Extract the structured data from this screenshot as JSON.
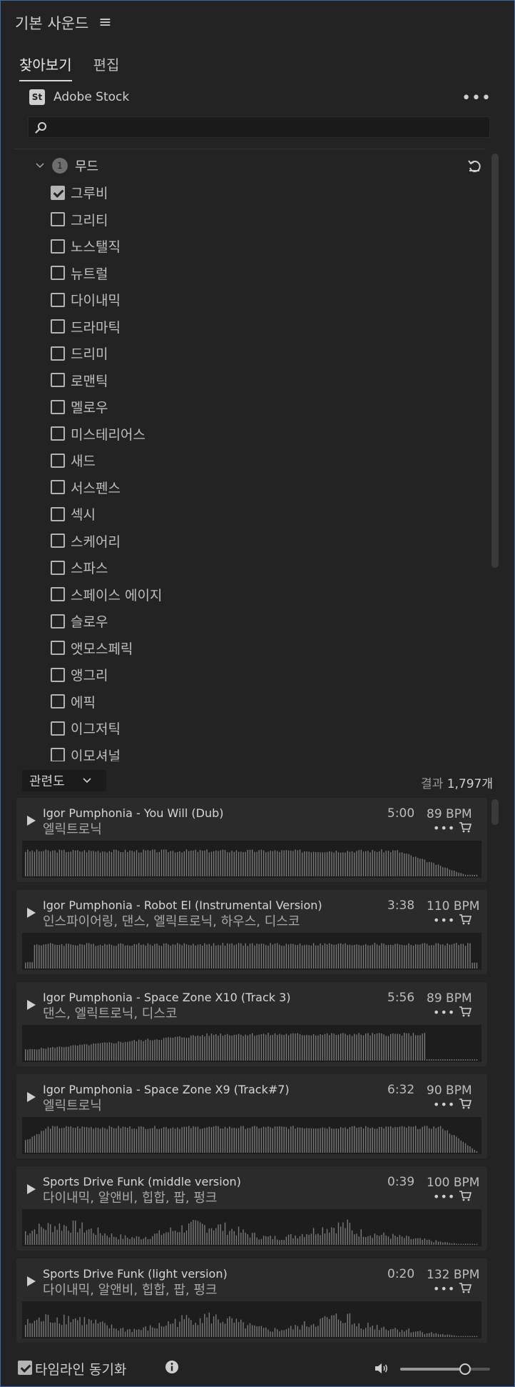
{
  "panel": {
    "title": "기본 사운드",
    "menu_icon": "hamburger-menu-icon"
  },
  "tabs": [
    {
      "label": "찾아보기",
      "active": true
    },
    {
      "label": "편집",
      "active": false
    }
  ],
  "stock": {
    "logo_text": "St",
    "label": "Adobe Stock",
    "more_icon": "ellipsis-icon"
  },
  "search": {
    "value": "",
    "placeholder": ""
  },
  "filter": {
    "count": "1",
    "title": "무드",
    "moods": [
      {
        "label": "그루비",
        "checked": true
      },
      {
        "label": "그리티",
        "checked": false
      },
      {
        "label": "노스탤직",
        "checked": false
      },
      {
        "label": "뉴트럴",
        "checked": false
      },
      {
        "label": "다이내믹",
        "checked": false
      },
      {
        "label": "드라마틱",
        "checked": false
      },
      {
        "label": "드리미",
        "checked": false
      },
      {
        "label": "로맨틱",
        "checked": false
      },
      {
        "label": "멜로우",
        "checked": false
      },
      {
        "label": "미스테리어스",
        "checked": false
      },
      {
        "label": "새드",
        "checked": false
      },
      {
        "label": "서스펜스",
        "checked": false
      },
      {
        "label": "섹시",
        "checked": false
      },
      {
        "label": "스케어리",
        "checked": false
      },
      {
        "label": "스파스",
        "checked": false
      },
      {
        "label": "스페이스 에이지",
        "checked": false
      },
      {
        "label": "슬로우",
        "checked": false
      },
      {
        "label": "앳모스페릭",
        "checked": false
      },
      {
        "label": "앵그리",
        "checked": false
      },
      {
        "label": "에픽",
        "checked": false
      },
      {
        "label": "이그저틱",
        "checked": false
      },
      {
        "label": "이모셔널",
        "checked": false
      }
    ]
  },
  "sort": {
    "label": "관련도"
  },
  "results": {
    "prefix": "결과",
    "count": "1,797개"
  },
  "tracks": [
    {
      "title": "Igor Pumphonia - You Will (Dub)",
      "genre": "엘릭트로닉",
      "duration": "5:00",
      "bpm": "89 BPM"
    },
    {
      "title": "Igor Pumphonia - Robot El (Instrumental Version)",
      "genre": "인스파이어링, 댄스, 엘릭트로닉, 하우스, 디스코",
      "duration": "3:38",
      "bpm": "110 BPM"
    },
    {
      "title": "Igor Pumphonia - Space Zone X10 (Track 3)",
      "genre": "댄스, 엘릭트로닉, 디스코",
      "duration": "5:56",
      "bpm": "89 BPM"
    },
    {
      "title": "Igor Pumphonia - Space Zone X9 (Track#7)",
      "genre": "엘릭트로닉",
      "duration": "6:32",
      "bpm": "90 BPM"
    },
    {
      "title": "Sports Drive Funk (middle version)",
      "genre": "다이내믹, 알앤비, 힙합, 팝, 펑크",
      "duration": "0:39",
      "bpm": "100 BPM"
    },
    {
      "title": "Sports Drive Funk (light version)",
      "genre": "다이내믹, 알앤비, 힙합, 팝, 펑크",
      "duration": "0:20",
      "bpm": "132 BPM"
    }
  ],
  "footer": {
    "sync_label": "타임라인 동기화",
    "sync_checked": true,
    "volume": 0.72
  },
  "colors": {
    "panel_bg": "#232323",
    "card_bg": "#2b2b2b",
    "waveform": "#7a7a7a",
    "border_accent": "#3d6aa8"
  }
}
